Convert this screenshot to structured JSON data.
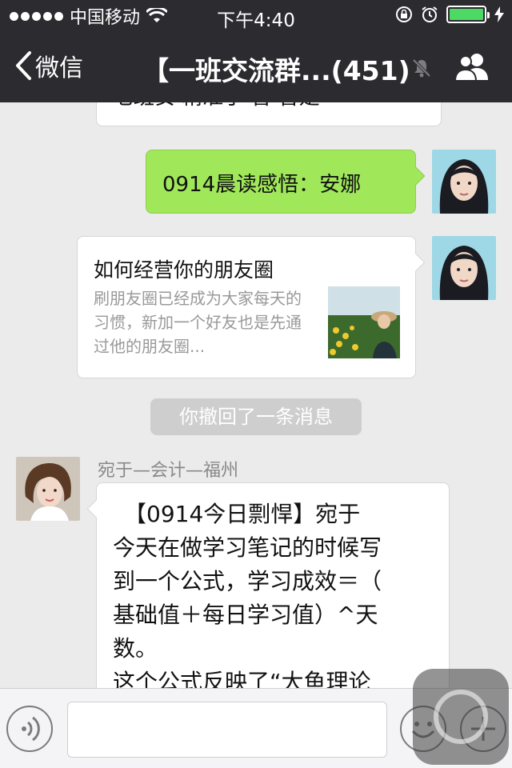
{
  "status_bar": {
    "carrier": "中国移动",
    "time": "下午4:40"
  },
  "nav": {
    "back_label": "微信",
    "title": "【一班交流群...(451)"
  },
  "messages": {
    "partial_top_text": "七班安 精准了 曾 曾是",
    "sent_text": "0914晨读感悟：安娜",
    "link_card": {
      "title": "如何经营你的朋友圈",
      "desc": "刷朋友圈已经成为大家每天的习惯，新加一个好友也是先通过他的朋友圈..."
    },
    "recall_notice": "你撤回了一条消息",
    "sender_name": "宛于—会计—福州",
    "long_lines": [
      "【0914今日剽悍】宛于",
      "今天在做学习笔记的时候写",
      "到一个公式，学习成效＝（",
      "基础值＋每日学习值）^天",
      "数。",
      "这个公式反映了“大鱼理论"
    ]
  },
  "colors": {
    "header_bg": "#2b2b30",
    "chat_bg": "#ebebeb",
    "bubble_green": "#a0e75a",
    "battery_green": "#4cd964"
  }
}
